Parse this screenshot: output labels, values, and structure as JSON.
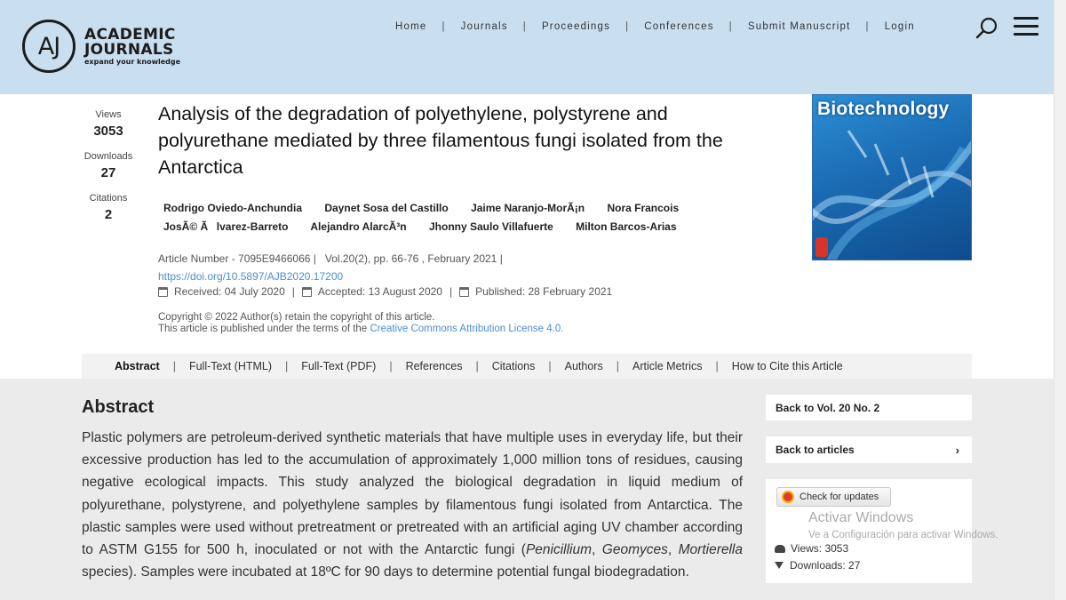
{
  "header": {
    "logo_mark": "AJ",
    "logo_line1": "ACADEMIC",
    "logo_line2": "JOURNALS",
    "logo_tagline": "expand your knowledge",
    "nav": [
      "Home",
      "Journals",
      "Proceedings",
      "Conferences",
      "Submit Manuscript",
      "Login"
    ]
  },
  "stats": {
    "views_label": "Views",
    "views_value": "3053",
    "downloads_label": "Downloads",
    "downloads_value": "27",
    "citations_label": "Citations",
    "citations_value": "2"
  },
  "article": {
    "title": "Analysis of the degradation of polyethylene, polystyrene and polyurethane mediated by three filamentous fungi isolated from the Antarctica",
    "authors_row1": [
      "Rodrigo Oviedo-Anchundia",
      "Daynet Sosa del Castillo",
      "Jaime Naranjo-MorÃ¡n",
      "Nora Francois"
    ],
    "authors_row2": [
      "JosÃ© Ãlvarez-Barreto",
      "Alejandro AlarcÃ³n",
      "Jhonny Saulo Villafuerte",
      "Milton Barcos-Arias"
    ],
    "article_number": "Article Number - 7095E9466066  |",
    "volume": "Vol.20(2), pp. 66-76 , February 2021  |",
    "doi": "https://doi.org/10.5897/AJB2020.17200",
    "received": "Received: 04 July 2020",
    "accepted": "Accepted: 13 August 2020",
    "published": "Published: 28 February 2021",
    "copyright_line1": "Copyright © 2022 Author(s) retain the copyright of this article.",
    "copyright_line2": "This article is published under the terms of the",
    "license_link": "Creative Commons Attribution License 4.0."
  },
  "cover": {
    "title": "Biotechnology",
    "brand_color": "#1b6bb3"
  },
  "tabs": [
    "Abstract",
    "Full-Text (HTML)",
    "Full-Text (PDF)",
    "References",
    "Citations",
    "Authors",
    "Article Metrics",
    "How to Cite this Article"
  ],
  "abstract": {
    "heading": "Abstract",
    "text_before": "Plastic polymers are petroleum-derived synthetic materials that have multiple uses in everyday life, but their excessive production has led to the accumulation of approximately 1,000 million tons of residues, causing negative ecological impacts. This study analyzed the biological degradation in liquid medium of polyurethane, polystyrene, and polyethylene samples by filamentous fungi isolated from Antarctica. The plastic samples were used without pretreatment or pretreated with an artificial aging UV chamber according to ASTM G155 for 500 h, inoculated or not with the Antarctic fungi (",
    "italic1": "Penicillium",
    "italic2": "Geomyces",
    "italic3": "Mortierella",
    "text_after": " species). Samples were incubated at 18ºC for 90 days to determine potential fungal biodegradation."
  },
  "sidebar": {
    "back_vol": "Back to Vol. 20 No. 2",
    "back_articles": "Back to articles",
    "check_updates": "Check for updates",
    "views": "Views: 3053",
    "downloads": "Downloads: 27"
  },
  "watermark": {
    "line1": "Activar Windows",
    "line2": "Ve a Configuración para activar Windows."
  }
}
